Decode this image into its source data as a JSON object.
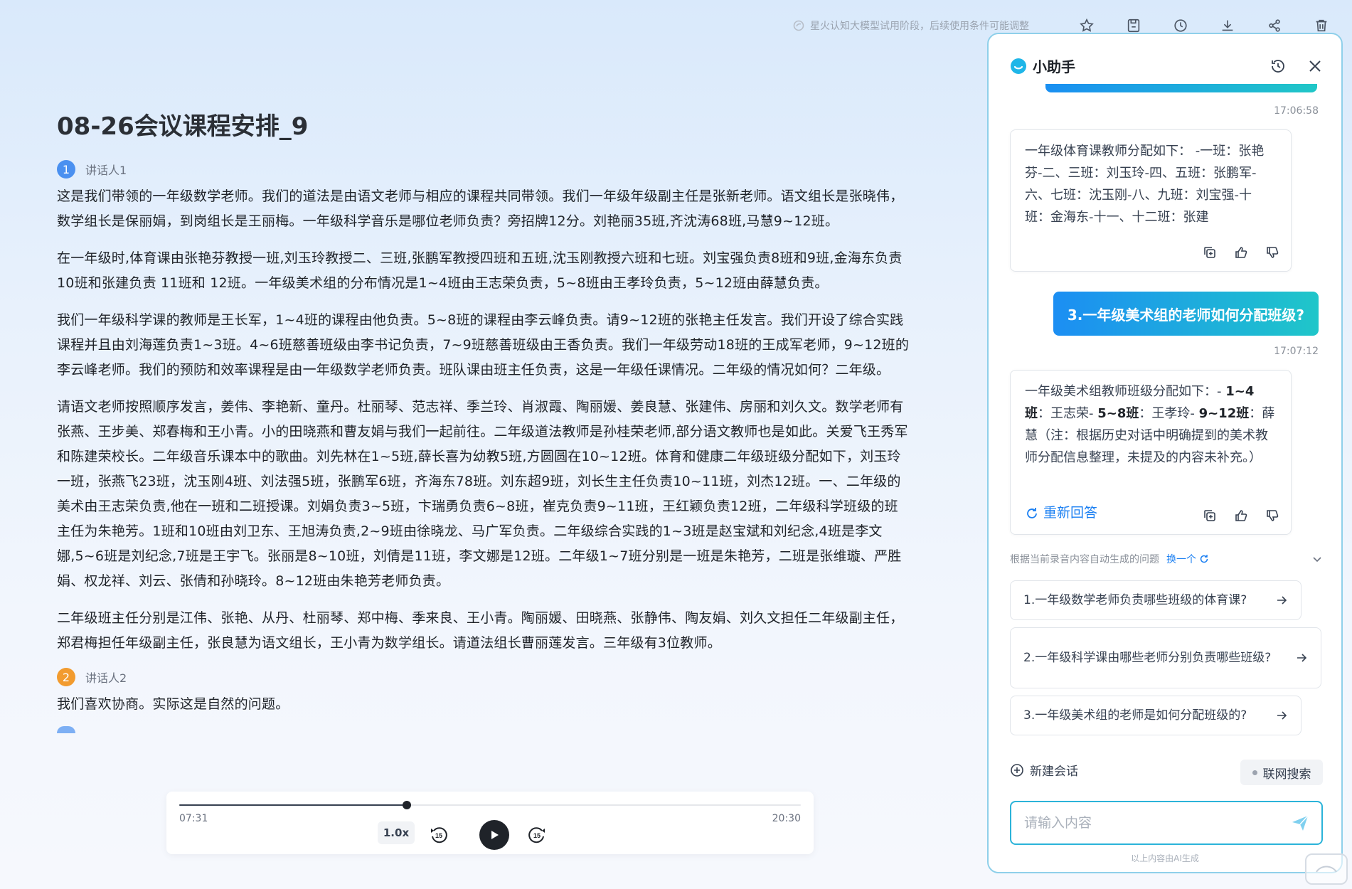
{
  "topbar": {
    "notice": "星火认知大模型试用阶段，后续使用条件可能调整",
    "icons": [
      "star-icon",
      "save-icon",
      "history-icon",
      "download-icon",
      "share-icon",
      "trash-icon"
    ]
  },
  "document": {
    "title": "08-26会议课程安排_9",
    "speaker1": {
      "num": "1",
      "name": "讲话人1",
      "color": "#4a90f0"
    },
    "speaker2": {
      "num": "2",
      "name": "讲话人2",
      "color": "#f29b2f"
    },
    "paragraphs": [
      "这是我们带领的一年级数学老师。我们的道法是由语文老师与相应的课程共同带领。我们一年级年级副主任是张新老师。语文组长是张晓伟，数学组长是保丽娟，到岗组长是王丽梅。一年级科学音乐是哪位老师负责？旁招牌12分。刘艳丽35班,齐沈涛68班,马慧9~12班。",
      "在一年级时,体育课由张艳芬教授一班,刘玉玲教授二、三班,张鹏军教授四班和五班,沈玉刚教授六班和七班。刘宝强负责8班和9班,金海东负责10班和张建负责 11班和 12班。一年级美术组的分布情况是1~4班由王志荣负责，5~8班由王孝玲负责，5~12班由薛慧负责。",
      "我们一年级科学课的教师是王长军，1~4班的课程由他负责。5~8班的课程由李云峰负责。请9~12班的张艳主任发言。我们开设了综合实践课程并且由刘海莲负责1~3班。4~6班慈善班级由李书记负责，7~9班慈善班级由王香负责。我们一年级劳动18班的王成军老师，9~12班的李云峰老师。我们的预防和效率课程是由一年级数学老师负责。班队课由班主任负责，这是一年级任课情况。二年级的情况如何？二年级。",
      "请语文老师按照顺序发言，姜伟、李艳新、童丹。杜丽琴、范志祥、季兰玲、肖淑霞、陶丽媛、姜良慧、张建伟、房丽和刘久文。数学老师有张燕、王步美、郑春梅和王小青。小的田晓燕和曹友娟与我们一起前往。二年级道法教师是孙桂荣老师,部分语文教师也是如此。关爱飞王秀军和陈建荣校长。二年级音乐课本中的歌曲。刘先林在1~5班,薛长喜为幼教5班,方圆圆在10~12班。体育和健康二年级班级分配如下，刘玉玲一班，张燕飞23班，沈玉刚4班、刘法强5班，张鹏军6班，齐海东78班。刘东超9班，刘长生主任负责10~11班，刘杰12班。一、二年级的美术由王志荣负责,他在一班和二班授课。刘娟负责3~5班，卞瑞勇负责6~8班，崔克负责9~11班，王红颖负责12班，二年级科学班级的班主任为朱艳芳。1班和10班由刘卫东、王旭涛负责,2~9班由徐晓龙、马广军负责。二年级综合实践的1~3班是赵宝斌和刘纪念,4班是李文娜,5~6班是刘纪念,7班是王宇飞。张丽是8~10班，刘倩是11班，李文娜是12班。二年级1~7班分别是一班是朱艳芳，二班是张维璇、严胜娟、权龙祥、刘云、张倩和孙晓玲。8~12班由朱艳芳老师负责。",
      "二年级班主任分别是江伟、张艳、从丹、杜丽琴、郑中梅、季来良、王小青。陶丽媛、田晓燕、张静伟、陶友娟、刘久文担任二年级副主任，郑君梅担任年级副主任，张良慧为语文组长，王小青为数学组长。请道法组长曹丽莲发言。三年级有3位教师。"
    ],
    "speaker2_text": "我们喜欢协商。实际这是自然的问题。"
  },
  "player": {
    "current": "07:31",
    "total": "20:30",
    "progress": 0.366,
    "speed": "1.0x",
    "rewind_label": "15",
    "forward_label": "15"
  },
  "assistant": {
    "title": "小助手",
    "ts1": "17:06:58",
    "answer1": "一年级体育课教师分配如下： -一班：张艳芬-二、三班：刘玉玲-四、五班：张鹏军-六、七班：沈玉刚-八、九班：刘宝强-十班：金海东-十一、十二班：张建",
    "question": "3.一年级美术组的老师如何分配班级?",
    "ts2": "17:07:12",
    "answer2": {
      "prefix": "一年级美术组教师班级分配如下：- ",
      "b1": "1~4班",
      "t1": "：王志荣- ",
      "b2": "5~8班",
      "t2": "：王孝玲- ",
      "b3": "9~12班",
      "t3": "：薛慧（注：根据历史对话中明确提到的美术教师分配信息整理，未提及的内容未补充。）"
    },
    "regen": "重新回答",
    "suggest_header": "根据当前录音内容自动生成的问题",
    "change": "换一个",
    "suggestions": [
      "1.一年级数学老师负责哪些班级的体育课?",
      "2.一年级科学课由哪些老师分别负责哪些班级?",
      "3.一年级美术组的老师是如何分配班级的?"
    ],
    "new_chat": "新建会话",
    "web_search": "联网搜索",
    "input_placeholder": "请输入内容",
    "footnote": "以上内容由AI生成"
  },
  "colors": {
    "accent": "#1a7ff2",
    "gradient_end": "#1fc6c9",
    "border": "#8fd0ea"
  }
}
